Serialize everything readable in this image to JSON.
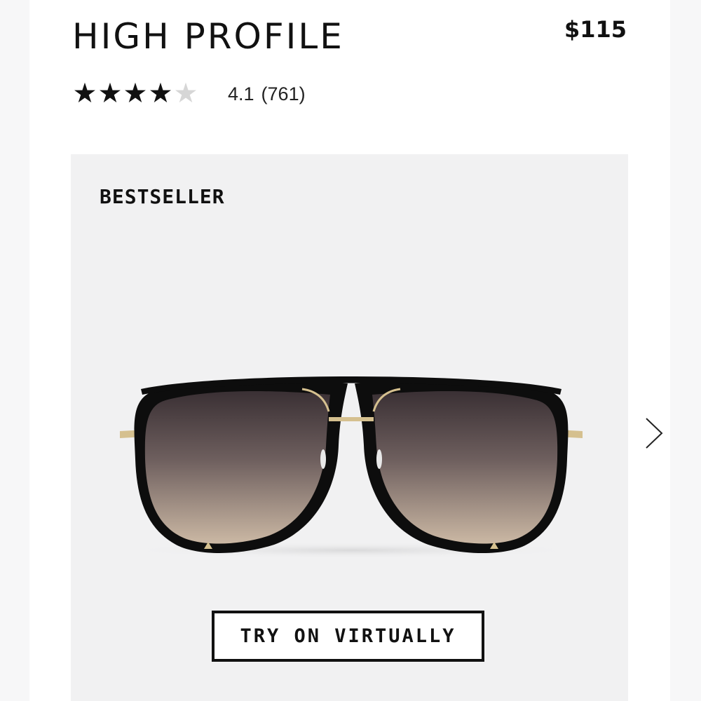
{
  "product": {
    "title": "HIGH PROFILE",
    "price": "$115"
  },
  "rating": {
    "value": "4.1",
    "count": "(761)",
    "stars_filled": 4,
    "stars_total": 5
  },
  "card": {
    "badge": "BESTSELLER",
    "try_on_label": "TRY ON VIRTUALLY",
    "image": "aviator-sunglasses",
    "next_icon": "chevron-right-icon"
  },
  "colors": {
    "text": "#111111",
    "card_background": "#f1f1f2",
    "star_empty": "#d6d6d6",
    "lens_top": "#3a3034",
    "lens_bottom": "#cbb8a4",
    "frame": "#0d0d0d",
    "metal": "#d5c08f"
  }
}
